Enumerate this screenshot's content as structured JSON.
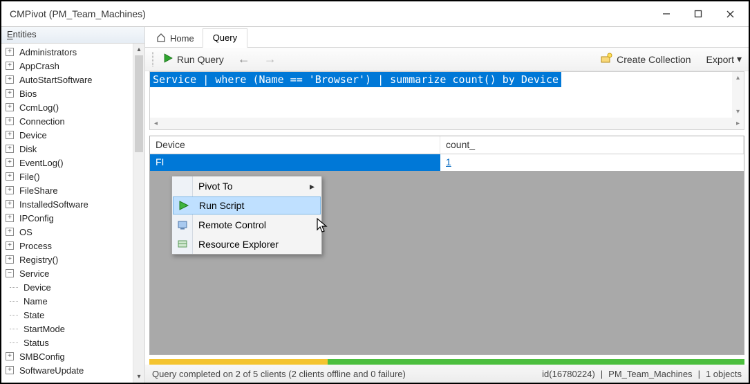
{
  "window": {
    "title": "CMPivot (PM_Team_Machines)"
  },
  "entities_header": {
    "prefix": "E",
    "rest": "ntities"
  },
  "tree": [
    {
      "label": "Administrators",
      "exp": "plus"
    },
    {
      "label": "AppCrash",
      "exp": "plus"
    },
    {
      "label": "AutoStartSoftware",
      "exp": "plus"
    },
    {
      "label": "Bios",
      "exp": "plus"
    },
    {
      "label": "CcmLog()",
      "exp": "plus"
    },
    {
      "label": "Connection",
      "exp": "plus"
    },
    {
      "label": "Device",
      "exp": "plus"
    },
    {
      "label": "Disk",
      "exp": "plus"
    },
    {
      "label": "EventLog()",
      "exp": "plus"
    },
    {
      "label": "File()",
      "exp": "plus"
    },
    {
      "label": "FileShare",
      "exp": "plus"
    },
    {
      "label": "InstalledSoftware",
      "exp": "plus"
    },
    {
      "label": "IPConfig",
      "exp": "plus"
    },
    {
      "label": "OS",
      "exp": "plus"
    },
    {
      "label": "Process",
      "exp": "plus"
    },
    {
      "label": "Registry()",
      "exp": "plus"
    },
    {
      "label": "Service",
      "exp": "minus",
      "children": [
        "Device",
        "Name",
        "State",
        "StartMode",
        "Status"
      ]
    },
    {
      "label": "SMBConfig",
      "exp": "plus"
    },
    {
      "label": "SoftwareUpdate",
      "exp": "plus"
    }
  ],
  "tabs": {
    "home": "Home",
    "query": "Query"
  },
  "toolbar": {
    "run": "Run Query",
    "create": "Create Collection",
    "export": "Export"
  },
  "query_text": "Service | where (Name == 'Browser') | summarize count() by Device",
  "grid": {
    "columns": {
      "device": "Device",
      "count": "count_"
    },
    "rows": [
      {
        "device": "FI",
        "count": "1"
      }
    ]
  },
  "context_menu": {
    "pivot": "Pivot To",
    "run_script": "Run Script",
    "remote": "Remote Control",
    "resource": "Resource Explorer"
  },
  "status": {
    "msg": "Query completed on 2 of 5 clients (2 clients offline and 0 failure)",
    "id": "id(16780224)",
    "coll": "PM_Team_Machines",
    "objs": "1 objects"
  }
}
